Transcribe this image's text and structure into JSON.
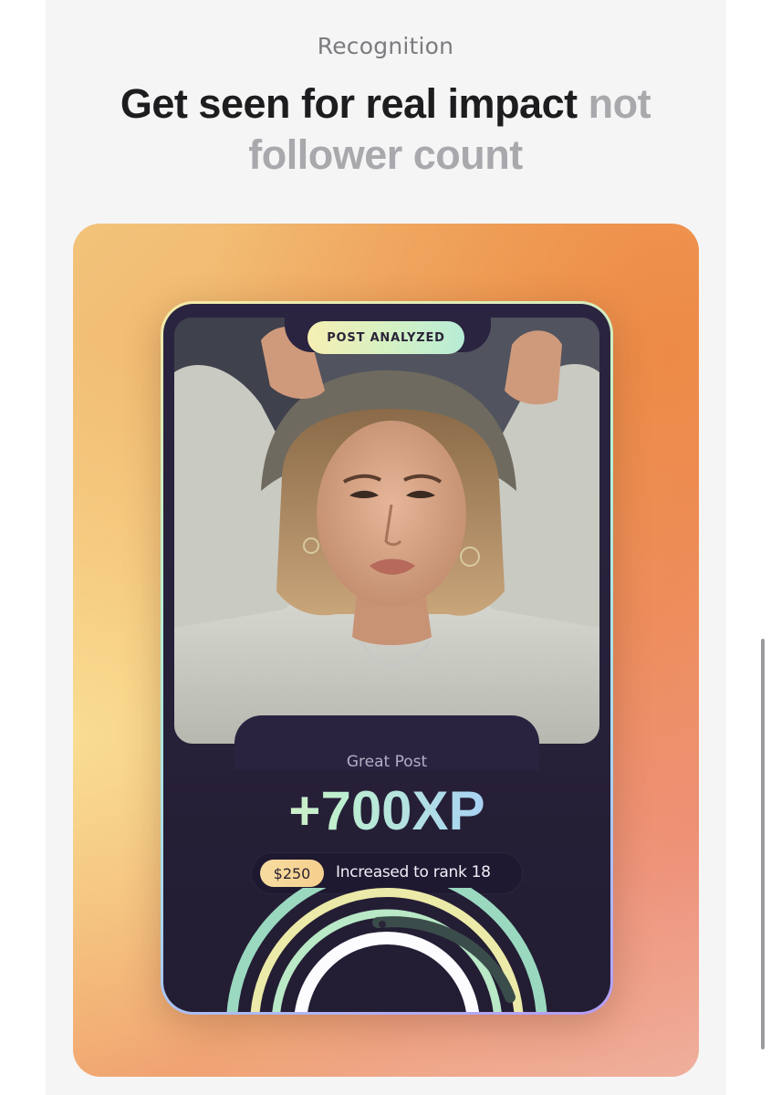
{
  "section": {
    "eyebrow": "Recognition",
    "headline_main": "Get seen for real impact",
    "headline_muted_1": "not",
    "headline_muted_2": "follower count"
  },
  "card": {
    "badge": "POST ANALYZED",
    "rating": "Great Post",
    "xp": "+700XP",
    "reward": "$250",
    "rank_message": "Increased to rank 18"
  },
  "colors": {
    "headline": "#1d1d1f",
    "headline_muted": "#a9a9ad",
    "card_bg": "#2b2440",
    "xp_gradient": [
      "#f3efb3",
      "#bdeed0",
      "#a9d4f2",
      "#a58af0"
    ],
    "reward_pill": "#f5cf8e"
  }
}
